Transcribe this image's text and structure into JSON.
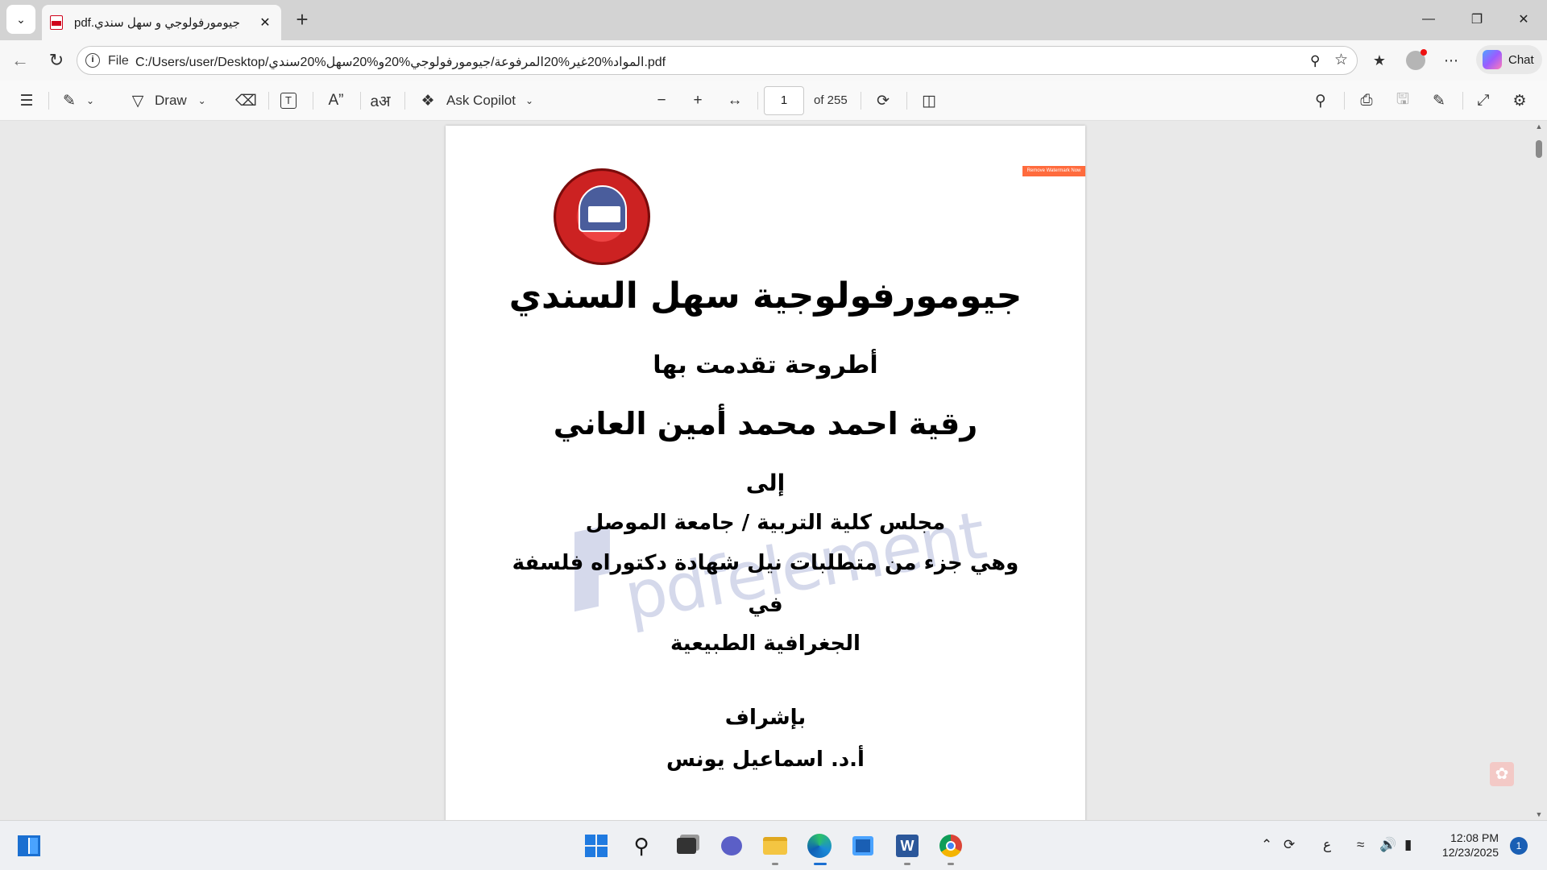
{
  "browser": {
    "tab_title": "جيومورفولوجي و سهل سندي.pdf",
    "address_scheme": "File",
    "address_url": "C:/Users/user/Desktop/المواد%20غير%20المرفوعة/جيومورفولوجي%20و%20سهل%20سندي.pdf",
    "chat_label": "Chat"
  },
  "pdf_toolbar": {
    "draw_label": "Draw",
    "ask_copilot_label": "Ask Copilot",
    "page_current": "1",
    "page_total": "of 255"
  },
  "document": {
    "watermark_button": "Remove Watermark Now",
    "watermark_text": "pdfelement",
    "lines": [
      "جيومورفولوجية سهل السندي",
      "أطروحة تقدمت بها",
      "رقية احمد محمد أمين العاني",
      "إلى",
      "مجلس كلية التربية / جامعة الموصل",
      "وهي جزء من متطلبات نيل شهادة دكتوراه فلسفة",
      "في",
      "الجغرافية الطبيعية",
      "بإشراف",
      "أ.د. اسماعيل يونس"
    ]
  },
  "taskbar": {
    "lang": "ع",
    "time": "12:08 PM",
    "date": "12/23/2025",
    "notifications": "1"
  }
}
